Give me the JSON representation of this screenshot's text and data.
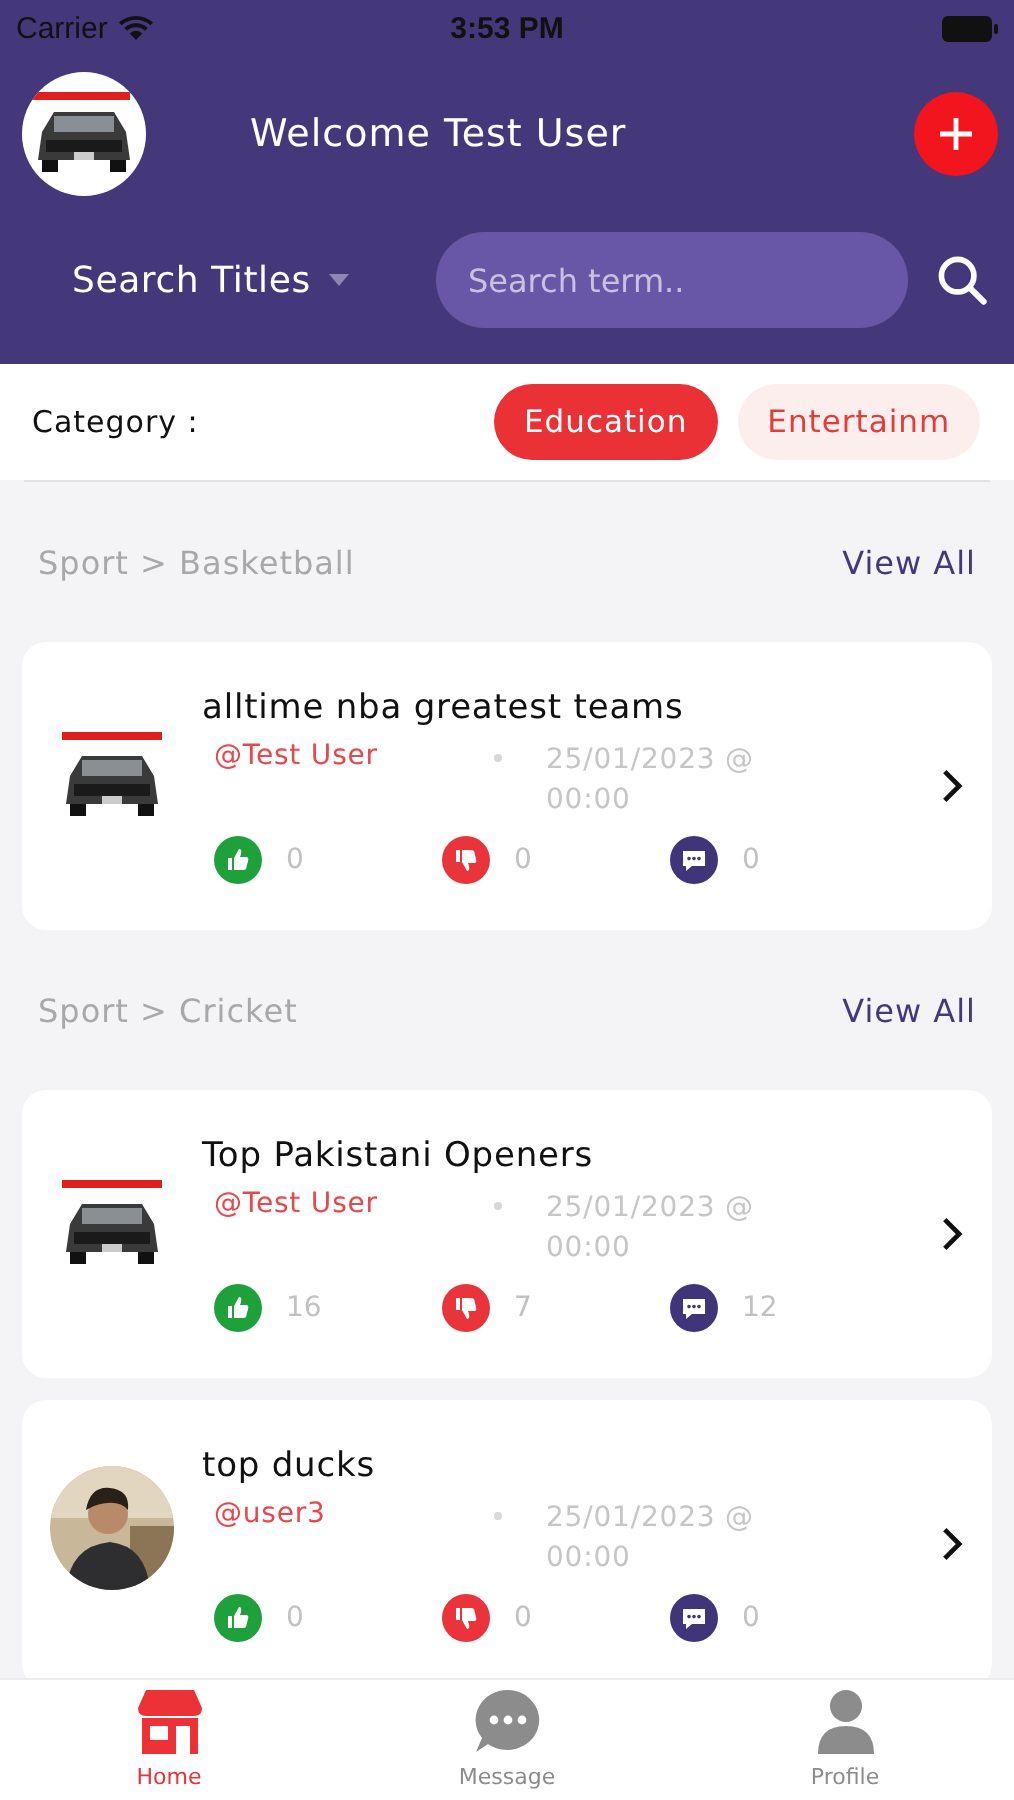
{
  "status_bar": {
    "carrier": "Carrier",
    "time": "3:53 PM"
  },
  "header": {
    "title": "Welcome Test User"
  },
  "search": {
    "selector": "Search Titles",
    "placeholder": "Search term.."
  },
  "category": {
    "label": "Category :",
    "items": [
      {
        "label": "Education",
        "selected": true
      },
      {
        "label": "Entertainm",
        "selected": false
      }
    ]
  },
  "sections": [
    {
      "path": "Sport > Basketball",
      "action": "View All",
      "posts": [
        {
          "title": "alltime nba greatest teams",
          "author": "@Test User",
          "date": "25/01/2023 @ 00:00",
          "likes": "0",
          "dislikes": "0",
          "comments": "0"
        }
      ]
    },
    {
      "path": "Sport > Cricket",
      "action": "View All",
      "posts": [
        {
          "title": "Top Pakistani Openers",
          "author": "@Test User",
          "date": "25/01/2023 @ 00:00",
          "likes": "16",
          "dislikes": "7",
          "comments": "12"
        },
        {
          "title": "top ducks",
          "author": "@user3",
          "date": "25/01/2023 @ 00:00",
          "likes": "0",
          "dislikes": "0",
          "comments": "0"
        }
      ]
    }
  ],
  "tab_bar": [
    {
      "label": "Home",
      "selected": true
    },
    {
      "label": "Message",
      "selected": false
    },
    {
      "label": "Profile",
      "selected": false
    }
  ]
}
